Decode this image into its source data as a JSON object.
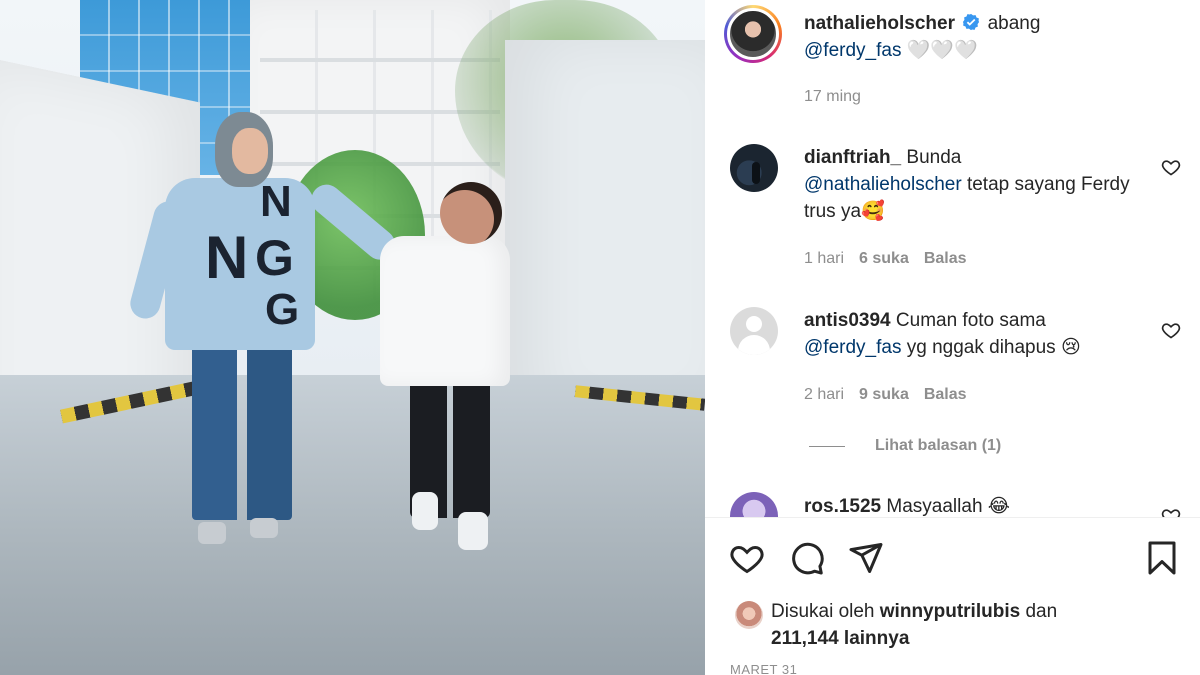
{
  "caption": {
    "username": "nathalieholscher",
    "verified": true,
    "text": "abang",
    "mention": "@ferdy_fas",
    "hearts": "🤍🤍🤍",
    "age": "17 ming"
  },
  "comments": [
    {
      "username": "dianftriah_",
      "text_before": "Bunda",
      "mention": "@nathalieholscher",
      "text_after": "tetap sayang Ferdy trus ya🥰",
      "time": "1 hari",
      "likes": "6 suka",
      "reply": "Balas"
    },
    {
      "username": "antis0394",
      "text_before": "Cuman foto sama",
      "mention": "@ferdy_fas",
      "text_after": "yg nggak dihapus 😢",
      "time": "2 hari",
      "likes": "9 suka",
      "reply": "Balas",
      "view_replies": "Lihat balasan (1)"
    },
    {
      "username": "ros.1525",
      "text_before": "Masyaallah 😂"
    }
  ],
  "photo": {
    "shirt_letters": [
      "N",
      "N",
      "G",
      "G"
    ]
  },
  "likes": {
    "prefix": "Disukai oleh",
    "user": "winnyputrilubis",
    "conj": "dan",
    "count": "211,144 lainnya"
  },
  "date": "MARET 31",
  "icons": {
    "like": "heart-icon",
    "comment": "comment-icon",
    "share": "share-icon",
    "save": "bookmark-icon",
    "comment_like": "heart-icon",
    "verified": "verified-badge-icon"
  },
  "colors": {
    "text": "#262626",
    "muted": "#8e8e8e",
    "mention": "#00376b",
    "verified": "#3897f0"
  }
}
